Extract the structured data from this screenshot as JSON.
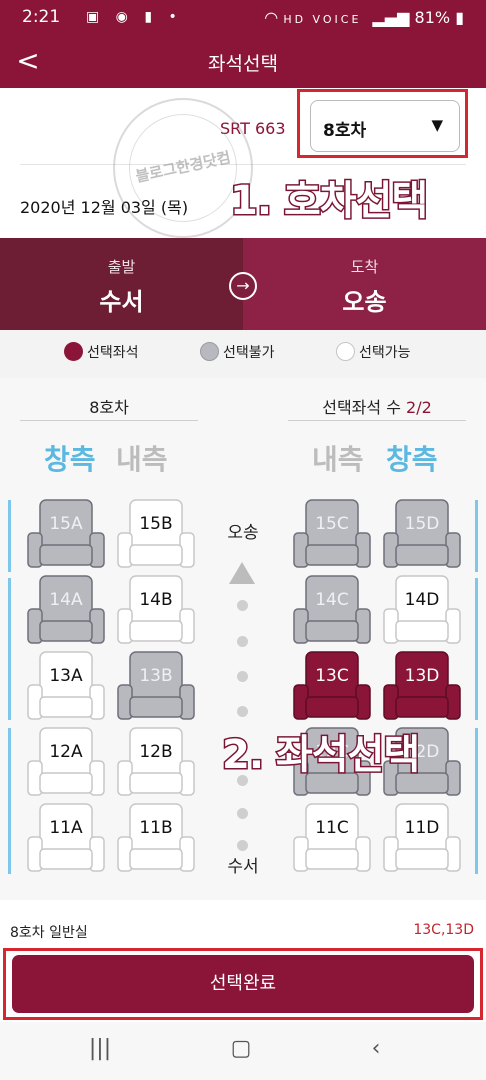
{
  "status_bar": {
    "time": "2:21",
    "net": "HD VOICE",
    "battery": "81%"
  },
  "app_bar": {
    "title": "좌석선택",
    "back_glyph": "<"
  },
  "train": {
    "number": "SRT 663",
    "car_selected": "8호차",
    "date": "2020년 12월 03일 (목)"
  },
  "route": {
    "departure_label": "출발",
    "departure": "수서",
    "arrival_label": "도착",
    "arrival": "오송"
  },
  "legend": {
    "selected": "선택좌석",
    "unavailable": "선택불가",
    "available": "선택가능"
  },
  "car_header": {
    "car": "8호차",
    "count_label": "선택좌석 수",
    "count_value": "2/2"
  },
  "sides": {
    "window": "창측",
    "aisle": "내측"
  },
  "stations": {
    "top": "오송",
    "bottom": "수서"
  },
  "seats": {
    "15A": "unavailable",
    "15B": "available",
    "15C": "unavailable",
    "15D": "unavailable",
    "14A": "unavailable",
    "14B": "available",
    "14C": "unavailable",
    "14D": "available",
    "13A": "available",
    "13B": "unavailable",
    "13C": "selected",
    "13D": "selected",
    "12A": "available",
    "12B": "available",
    "12C": "unavailable",
    "12D": "unavailable",
    "11A": "available",
    "11B": "available",
    "11C": "available",
    "11D": "available"
  },
  "annotations": {
    "step1": "1. 호차선택",
    "step2": "2. 좌석선택"
  },
  "watermark": "블로그한경닷컴",
  "footer": {
    "car_info": "8호차 일반실",
    "selected_seats": "13C,13D",
    "done_button": "선택완료"
  },
  "colors": {
    "brand": "#8a1538",
    "window_side": "#5bb8e0",
    "highlight": "#d6262f"
  }
}
